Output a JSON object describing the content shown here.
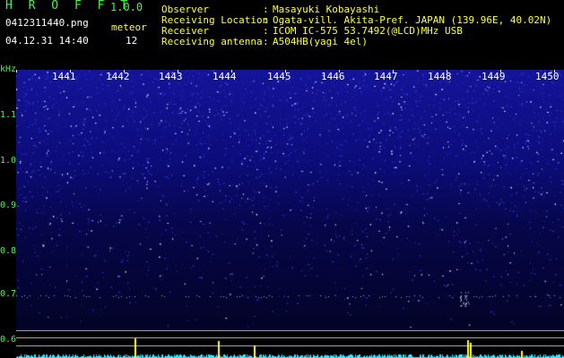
{
  "header": {
    "app_title": "H R O F F T",
    "app_version": "1.0.0",
    "file_name": "0412311440.png",
    "meteor_label": "meteor",
    "timestamp": "04.12.31 14:40",
    "meteor_count": "12"
  },
  "info": [
    {
      "label": "Observer",
      "value": "Masayuki Kobayashi"
    },
    {
      "label": "Receiving Location",
      "value": "Ogata-vill. Akita-Pref. JAPAN (139.96E, 40.02N)"
    },
    {
      "label": "Receiver",
      "value": "ICOM IC-575 53.7492(@LCD)MHz USB"
    },
    {
      "label": "Receiving antenna",
      "value": "A504HB(yagi 4el)"
    }
  ],
  "separator": ":",
  "axis": {
    "unit": "kHz",
    "y_labels": [
      "1.1",
      "1.0",
      "0.9",
      "0.8",
      "0.7",
      "0.6"
    ],
    "minutes": [
      "1441",
      "1442",
      "1443",
      "1444",
      "1445",
      "1446",
      "1447",
      "1448",
      "1449",
      "1450"
    ]
  },
  "colors": {
    "header_green": "#39ff39",
    "header_yellow": "#ffff33",
    "noise_blue": "#2f3fe0",
    "spectrum_cyan": "#33e6ff",
    "meteor_yellow": "#ffff33"
  }
}
